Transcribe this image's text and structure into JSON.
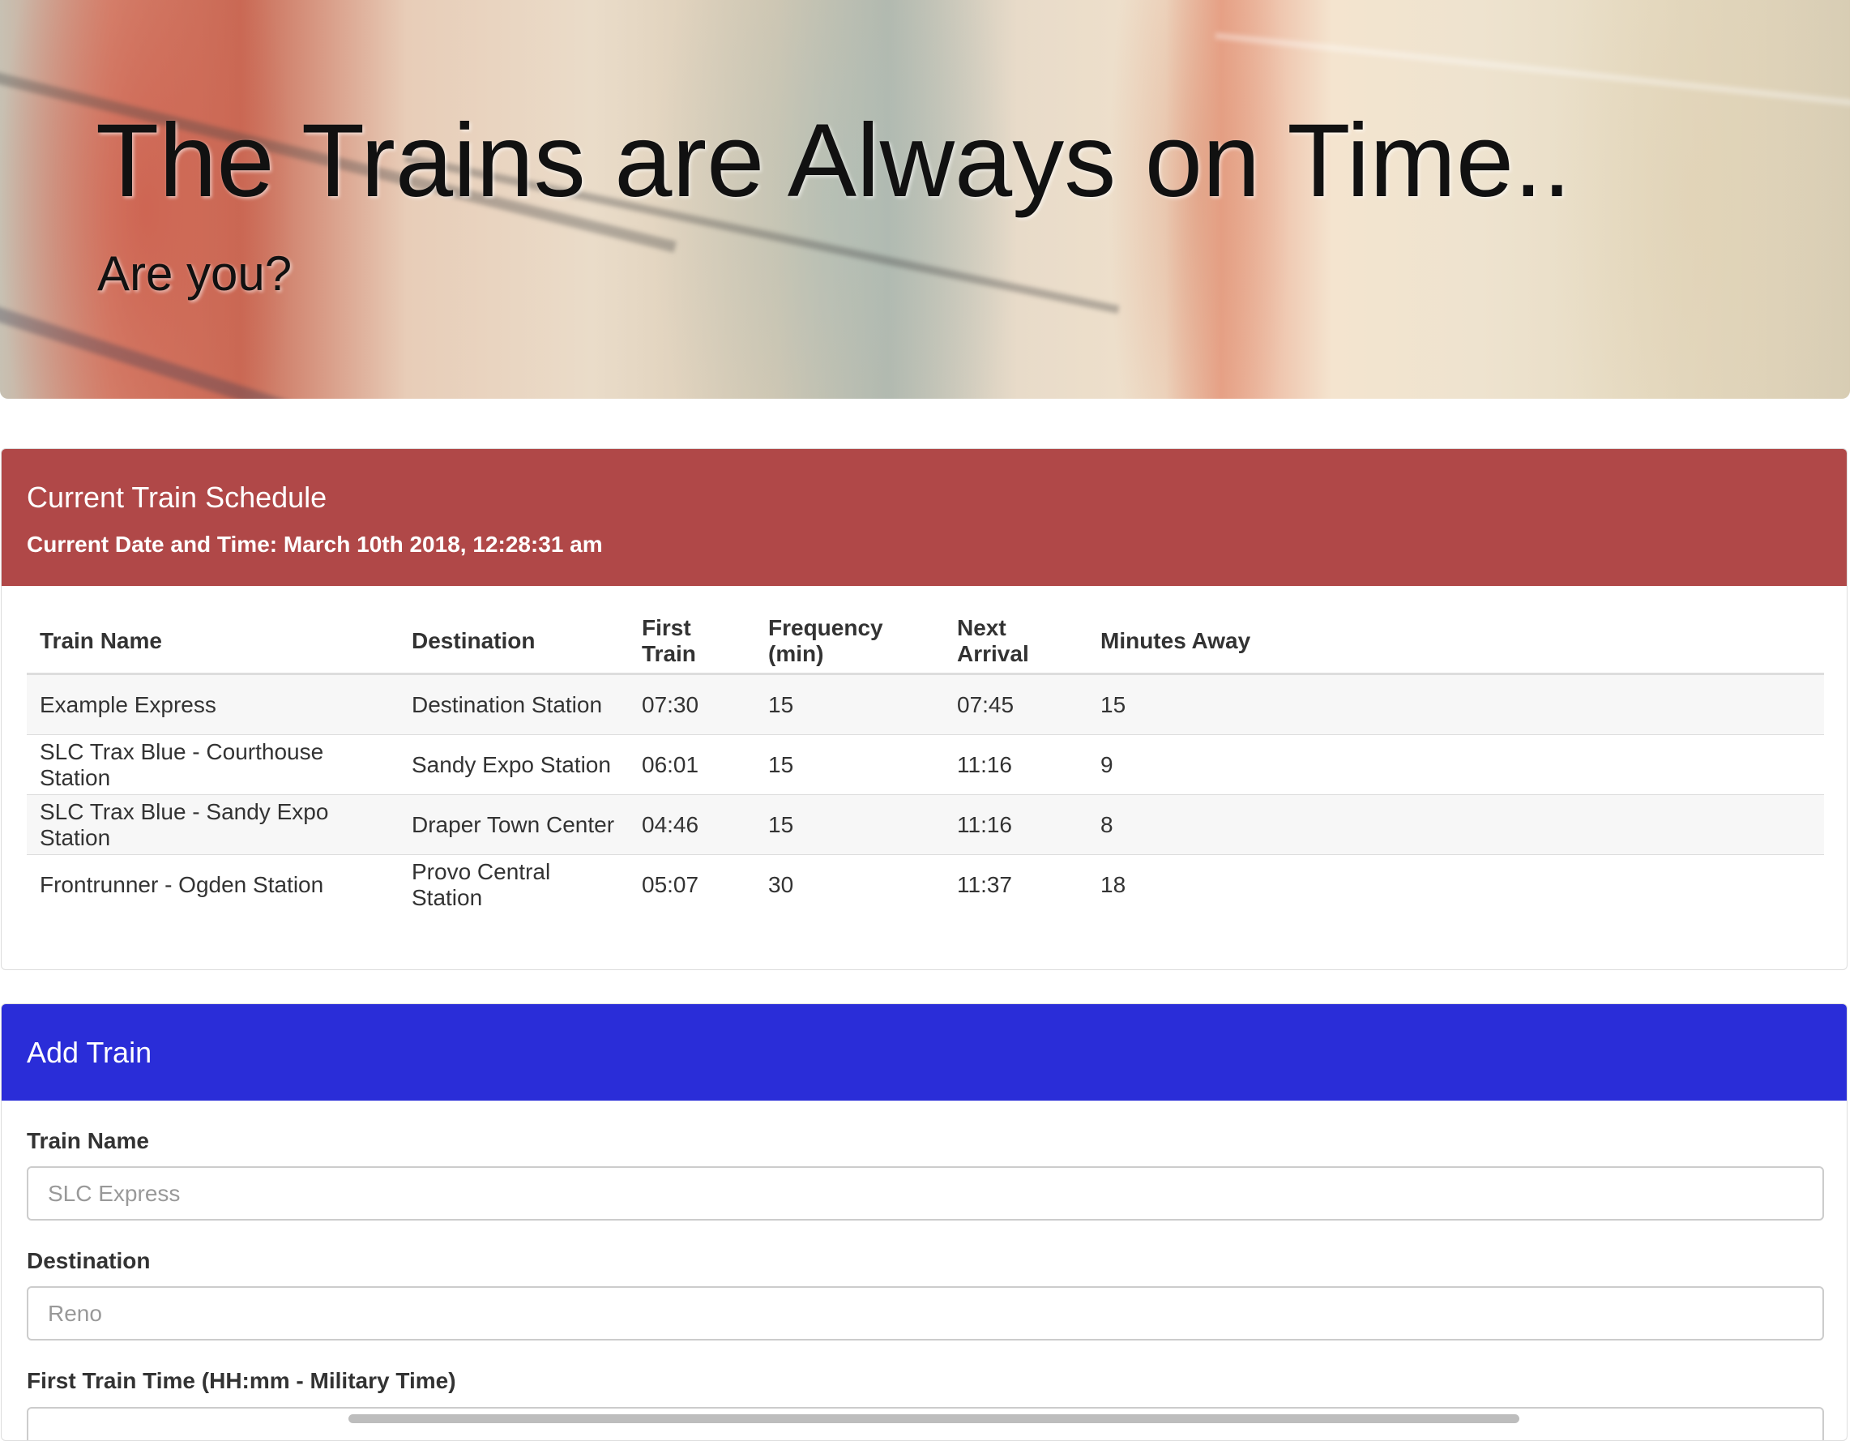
{
  "hero": {
    "title": "The Trains are Always on Time..",
    "subtitle": "Are you?"
  },
  "schedule": {
    "title": "Current Train Schedule",
    "datetime": "Current Date and Time: March 10th 2018, 12:28:31 am",
    "columns": [
      "Train Name",
      "Destination",
      "First Train",
      "Frequency (min)",
      "Next Arrival",
      "Minutes Away"
    ],
    "rows": [
      [
        "Example Express",
        "Destination Station",
        "07:30",
        "15",
        "07:45",
        "15"
      ],
      [
        "SLC Trax Blue - Courthouse Station",
        "Sandy Expo Station",
        "06:01",
        "15",
        "11:16",
        "9"
      ],
      [
        "SLC Trax Blue - Sandy Expo Station",
        "Draper Town Center",
        "04:46",
        "15",
        "11:16",
        "8"
      ],
      [
        "Frontrunner - Ogden Station",
        "Provo Central Station",
        "05:07",
        "30",
        "11:37",
        "18"
      ]
    ]
  },
  "add_train": {
    "title": "Add Train",
    "fields": {
      "train_name": {
        "label": "Train Name",
        "value": "",
        "placeholder": "SLC Express"
      },
      "destination": {
        "label": "Destination",
        "value": "",
        "placeholder": "Reno"
      },
      "first_train_time": {
        "label": "First Train Time (HH:mm - Military Time)",
        "value": "",
        "placeholder": ""
      }
    }
  },
  "colors": {
    "schedule_header": "#b04848",
    "add_train_header": "#2a2dd8"
  }
}
